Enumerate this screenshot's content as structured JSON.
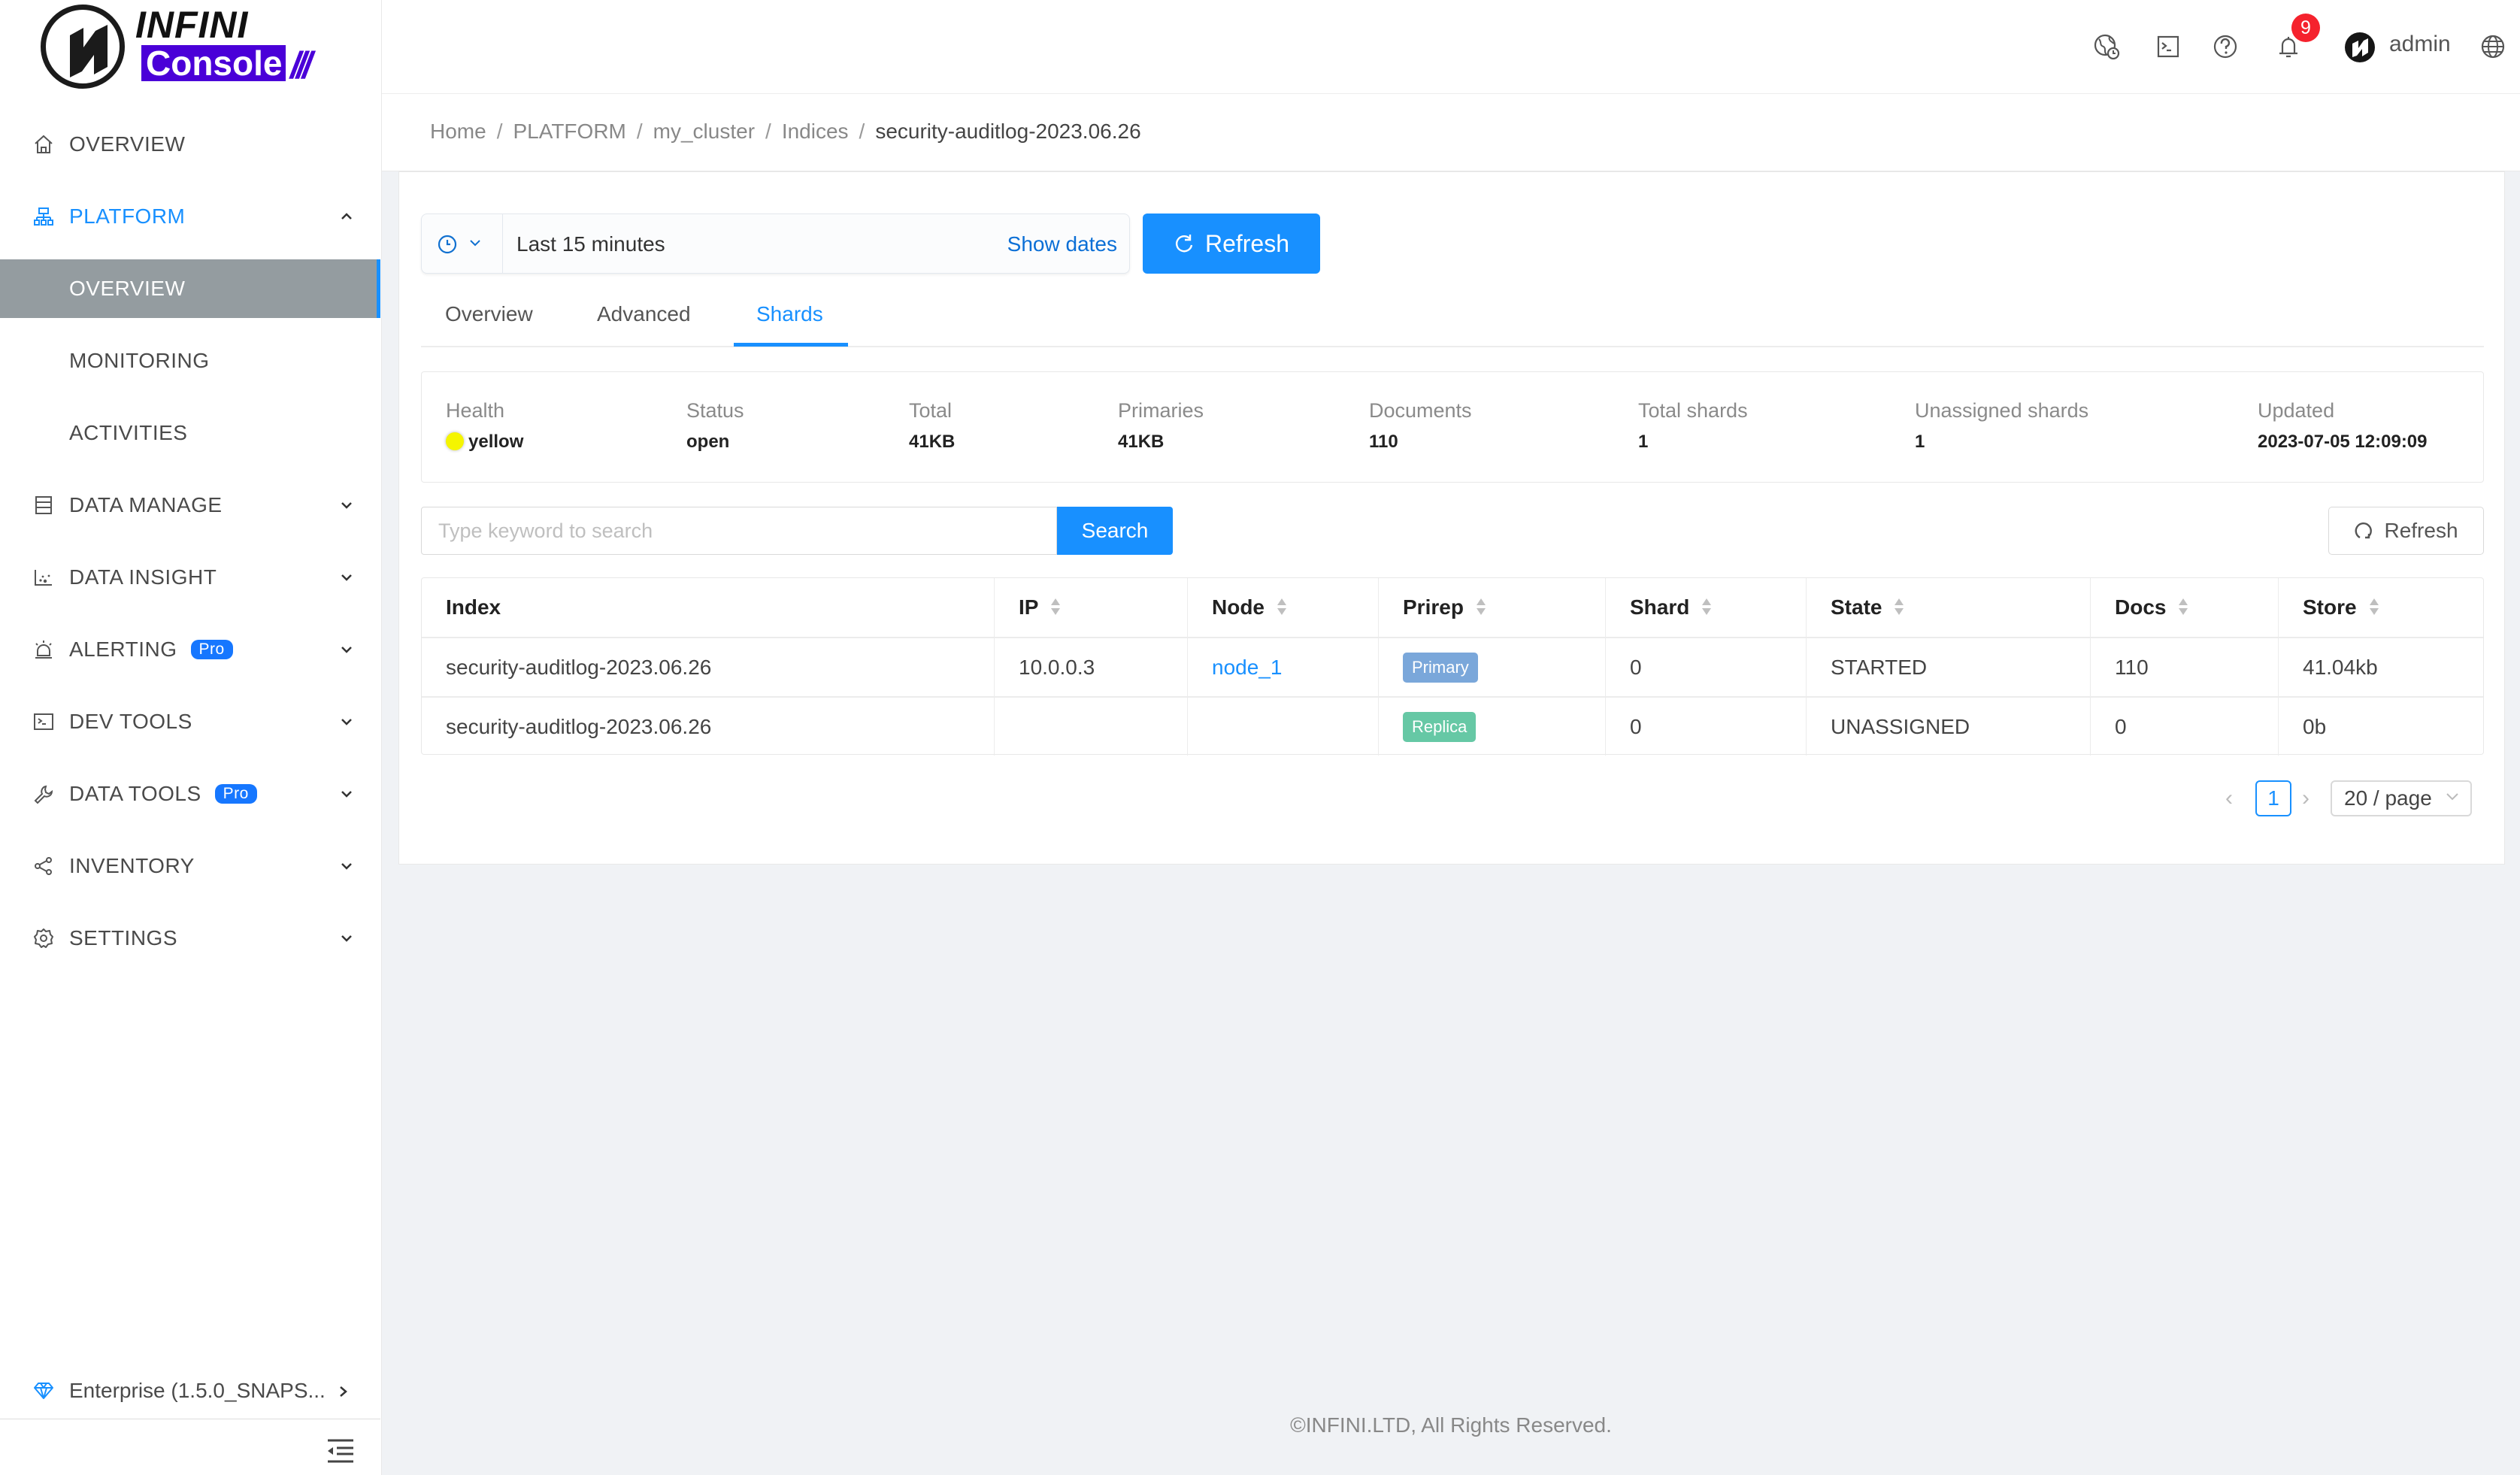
{
  "app": {
    "logo_top": "INFINI",
    "logo_bottom": "Console",
    "logo_slashes": "///"
  },
  "header": {
    "icons": [
      "globe-clock-icon",
      "terminal-icon",
      "help-icon",
      "bell-icon",
      "avatar",
      "language-icon"
    ],
    "notification_count": "9",
    "user_name": "admin"
  },
  "sidebar": {
    "items": [
      {
        "label": "OVERVIEW",
        "icon": "home-icon"
      },
      {
        "label": "PLATFORM",
        "icon": "cluster-icon",
        "expanded": true
      },
      {
        "label": "OVERVIEW",
        "selected": true
      },
      {
        "label": "MONITORING"
      },
      {
        "label": "ACTIVITIES"
      },
      {
        "label": "DATA MANAGE",
        "icon": "database-icon"
      },
      {
        "label": "DATA INSIGHT",
        "icon": "chart-icon"
      },
      {
        "label": "ALERTING",
        "icon": "alarm-icon",
        "badge": "Pro"
      },
      {
        "label": "DEV TOOLS",
        "icon": "terminal-icon"
      },
      {
        "label": "DATA TOOLS",
        "icon": "wrench-icon",
        "badge": "Pro"
      },
      {
        "label": "INVENTORY",
        "icon": "share-icon"
      },
      {
        "label": "SETTINGS",
        "icon": "gear-icon"
      }
    ],
    "edition": "Enterprise (1.5.0_SNAPS..."
  },
  "breadcrumb": [
    "Home",
    "PLATFORM",
    "my_cluster",
    "Indices",
    "security-auditlog-2023.06.26"
  ],
  "time_picker": {
    "value": "Last 15 minutes",
    "show_dates": "Show dates",
    "refresh_label": "Refresh"
  },
  "tabs": [
    {
      "label": "Overview"
    },
    {
      "label": "Advanced"
    },
    {
      "label": "Shards",
      "active": true
    }
  ],
  "stats": [
    {
      "key": "Health",
      "value": "yellow",
      "color": "#f5f500"
    },
    {
      "key": "Status",
      "value": "open"
    },
    {
      "key": "Total",
      "value": "41KB"
    },
    {
      "key": "Primaries",
      "value": "41KB"
    },
    {
      "key": "Documents",
      "value": "110"
    },
    {
      "key": "Total shards",
      "value": "1"
    },
    {
      "key": "Unassigned shards",
      "value": "1"
    },
    {
      "key": "Updated",
      "value": "2023-07-05 12:09:09"
    }
  ],
  "search": {
    "placeholder": "Type keyword to search",
    "value": "",
    "button_label": "Search",
    "refresh_label": "Refresh"
  },
  "table": {
    "columns": [
      "Index",
      "IP",
      "Node",
      "Prirep",
      "Shard",
      "State",
      "Docs",
      "Store"
    ],
    "rows": [
      {
        "index": "security-auditlog-2023.06.26",
        "ip": "10.0.0.3",
        "node": "node_1",
        "prirep": "Primary",
        "shard": "0",
        "state": "STARTED",
        "docs": "110",
        "store": "41.04kb"
      },
      {
        "index": "security-auditlog-2023.06.26",
        "ip": "",
        "node": "",
        "prirep": "Replica",
        "shard": "0",
        "state": "UNASSIGNED",
        "docs": "0",
        "store": "0b"
      }
    ]
  },
  "pagination": {
    "current_page": "1",
    "page_size": "20 / page"
  },
  "colors": {
    "accent": "#1890ff",
    "primary_tag": "#7aa7da",
    "replica_tag": "#66c8a5",
    "badge": "#f5222d",
    "brand": "#4a00d8"
  },
  "footer": "©INFINI.LTD, All Rights Reserved."
}
